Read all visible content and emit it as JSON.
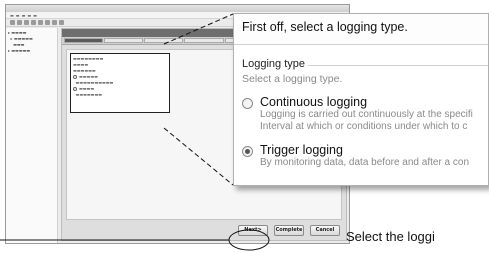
{
  "callout": {
    "header": "First off, select a logging type.",
    "group_title": "Logging type",
    "group_hint": "Select a logging type.",
    "options": [
      {
        "title": "Continuous logging",
        "desc1": "Logging is carried out continuously at the specifi",
        "desc2": "Interval at which or conditions under which to c",
        "selected": false
      },
      {
        "title": "Trigger logging",
        "desc1": "By monitoring data, data before and after a con",
        "desc2": "",
        "selected": true
      }
    ]
  },
  "caption": "Select the loggi",
  "wizard": {
    "buttons": {
      "next": "Next>",
      "complete": "Complete",
      "cancel": "Cancel"
    }
  }
}
